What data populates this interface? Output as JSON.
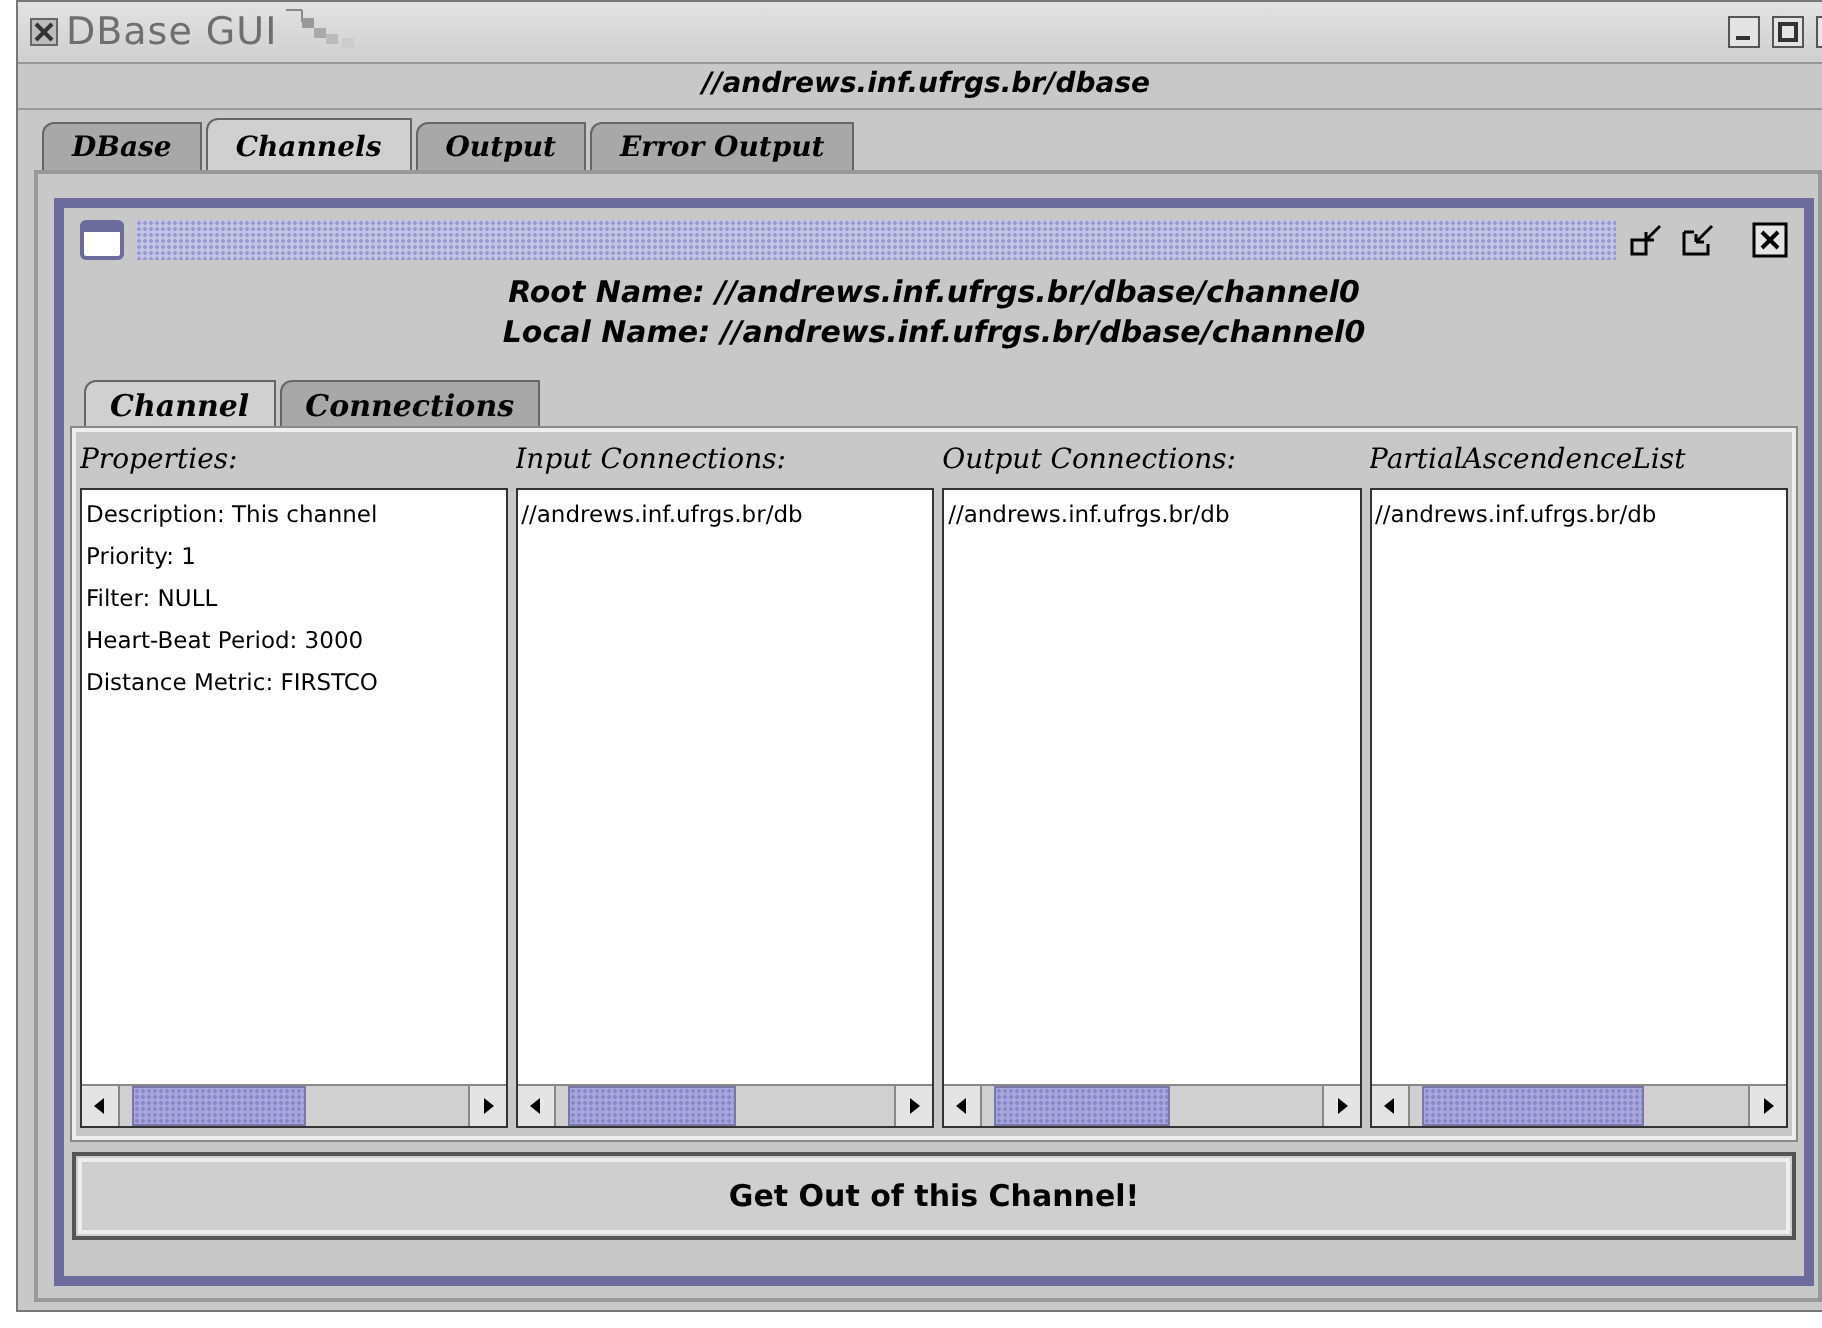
{
  "window": {
    "title": "DBase GUI"
  },
  "address": "//andrews.inf.ufrgs.br/dbase",
  "tabs": [
    {
      "label": "DBase",
      "selected": false
    },
    {
      "label": "Channels",
      "selected": true
    },
    {
      "label": "Output",
      "selected": false
    },
    {
      "label": "Error Output",
      "selected": false
    }
  ],
  "channel_frame": {
    "root_name": {
      "label": "Root Name:",
      "value": "//andrews.inf.ufrgs.br/dbase/channel0"
    },
    "local_name": {
      "label": "Local Name:",
      "value": "//andrews.inf.ufrgs.br/dbase/channel0"
    },
    "tabs": [
      {
        "label": "Channel",
        "selected": true
      },
      {
        "label": "Connections",
        "selected": false
      }
    ],
    "lists": [
      {
        "header": "Properties:",
        "items": [
          "Description: This channel",
          "Priority: 1",
          "Filter: NULL",
          "Heart-Beat Period: 3000",
          "Distance Metric: FIRSTCO"
        ]
      },
      {
        "header": "Input Connections:",
        "items": [
          "//andrews.inf.ufrgs.br/db"
        ]
      },
      {
        "header": "Output Connections:",
        "items": [
          "//andrews.inf.ufrgs.br/db"
        ]
      },
      {
        "header": "PartialAscendenceList",
        "items": [
          "//andrews.inf.ufrgs.br/db"
        ]
      }
    ],
    "button": "Get Out of this Channel!"
  }
}
